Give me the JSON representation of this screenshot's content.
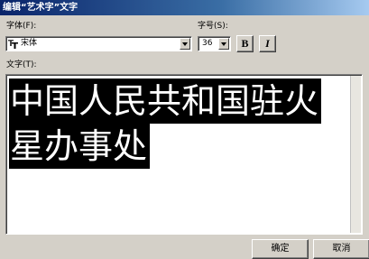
{
  "window": {
    "title": "编辑“艺术字”文字"
  },
  "font": {
    "label": "字体(F):",
    "value": "宋体",
    "type_icon": "truetype-icon"
  },
  "size": {
    "label": "字号(S):",
    "value": "36"
  },
  "format": {
    "bold": "B",
    "italic": "I"
  },
  "text": {
    "label": "文字(T):",
    "lines": [
      "中国人民共和国驻火",
      "星办事处"
    ]
  },
  "buttons": {
    "ok": "确定",
    "cancel": "取消"
  }
}
